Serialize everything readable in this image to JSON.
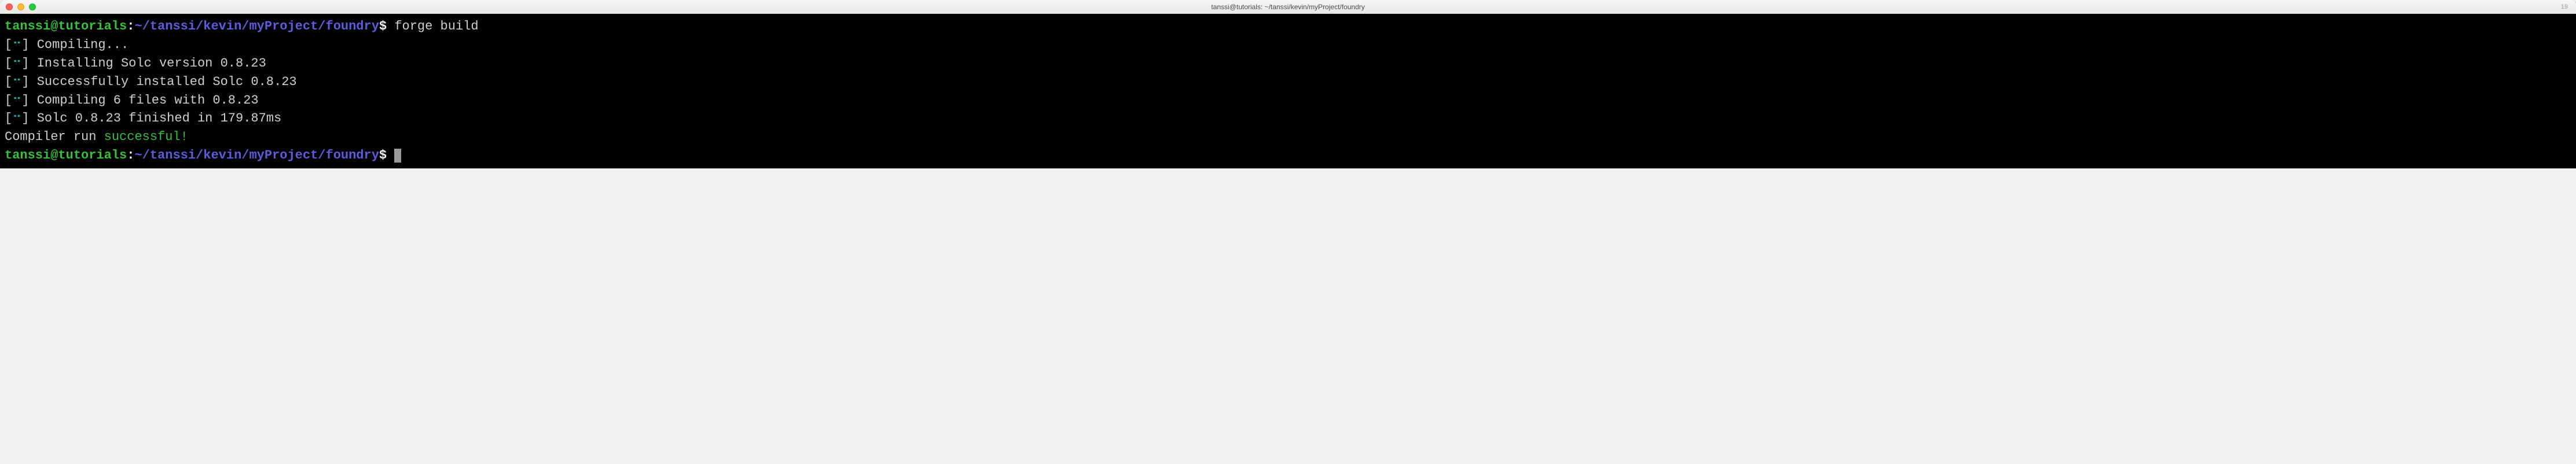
{
  "window": {
    "title": "tanssi@tutorials: ~/tanssi/kevin/myProject/foundry",
    "tab_count": "19"
  },
  "prompt": {
    "user_host": "tanssi@tutorials",
    "sep": ":",
    "path": "~/tanssi/kevin/myProject/foundry",
    "symbol": "$"
  },
  "command": "forge build",
  "spinner": {
    "open": "[",
    "dots": "⠒",
    "close": "]"
  },
  "output": {
    "l1": " Compiling...",
    "l2": " Installing Solc version 0.8.23",
    "l3": " Successfully installed Solc 0.8.23",
    "l4": " Compiling 6 files with 0.8.23",
    "l5": " Solc 0.8.23 finished in 179.87ms",
    "compiler_prefix": "Compiler run ",
    "compiler_status": "successful!"
  }
}
